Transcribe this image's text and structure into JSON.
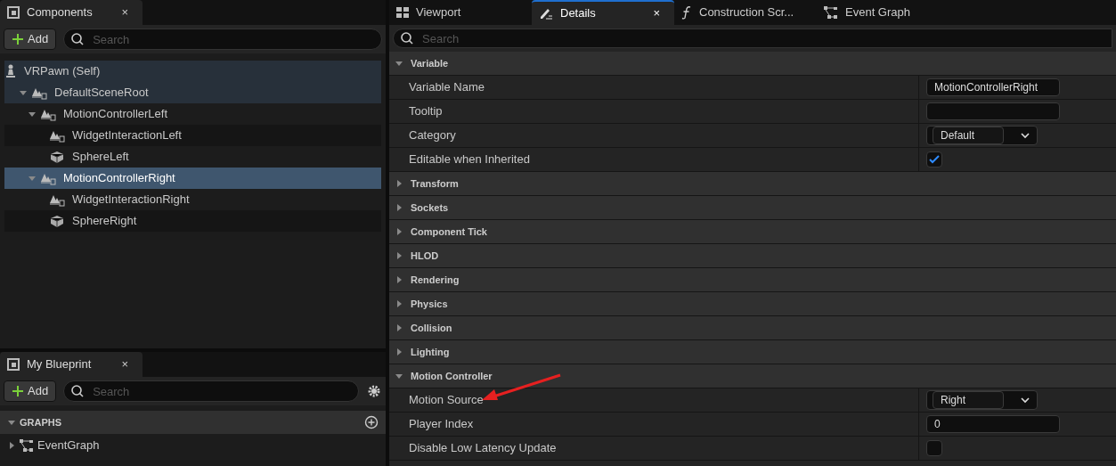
{
  "components_panel": {
    "tab": {
      "label": "Components",
      "close": "×"
    },
    "add_button": "Add",
    "search": {
      "placeholder": "Search"
    },
    "tree": [
      {
        "label": "VRPawn (Self)",
        "kind": "pawn",
        "selected": false,
        "inherited": true,
        "children": [
          {
            "label": "DefaultSceneRoot",
            "kind": "scene",
            "selected": false,
            "inherited": true,
            "expanded": true,
            "children": [
              {
                "label": "MotionControllerLeft",
                "kind": "scene",
                "selected": false,
                "inherited": false,
                "expanded": true,
                "children": [
                  {
                    "label": "WidgetInteractionLeft",
                    "kind": "scene",
                    "selected": false,
                    "inherited": false
                  },
                  {
                    "label": "SphereLeft",
                    "kind": "mesh",
                    "selected": false,
                    "inherited": false
                  }
                ]
              },
              {
                "label": "MotionControllerRight",
                "kind": "scene",
                "selected": true,
                "inherited": false,
                "expanded": true,
                "children": [
                  {
                    "label": "WidgetInteractionRight",
                    "kind": "scene",
                    "selected": false,
                    "inherited": false
                  },
                  {
                    "label": "SphereRight",
                    "kind": "mesh",
                    "selected": false,
                    "inherited": false
                  }
                ]
              }
            ]
          }
        ]
      }
    ]
  },
  "blueprint_panel": {
    "tab": {
      "label": "My Blueprint",
      "close": "×"
    },
    "add_button": "Add",
    "search": {
      "placeholder": "Search"
    },
    "section": {
      "label": "GRAPHS",
      "expanded": true
    },
    "items": [
      {
        "label": "EventGraph",
        "expanded": false
      }
    ]
  },
  "tabs": [
    {
      "label": "Viewport",
      "selected": false
    },
    {
      "label": "Details",
      "selected": true,
      "close": "×"
    },
    {
      "label": "Construction Scr...",
      "selected": false
    },
    {
      "label": "Event Graph",
      "selected": false
    }
  ],
  "details": {
    "search": {
      "placeholder": "Search"
    },
    "sections": [
      {
        "label": "Variable",
        "expanded": true,
        "rows": [
          {
            "label": "Variable Name",
            "kind": "text",
            "value": "MotionControllerRight"
          },
          {
            "label": "Tooltip",
            "kind": "text",
            "value": ""
          },
          {
            "label": "Category",
            "kind": "dropdown",
            "value": "Default"
          },
          {
            "label": "Editable when Inherited",
            "kind": "checkbox",
            "checked": true
          }
        ]
      },
      {
        "label": "Transform",
        "expanded": false
      },
      {
        "label": "Sockets",
        "expanded": false
      },
      {
        "label": "Component Tick",
        "expanded": false
      },
      {
        "label": "HLOD",
        "expanded": false
      },
      {
        "label": "Rendering",
        "expanded": false
      },
      {
        "label": "Physics",
        "expanded": false
      },
      {
        "label": "Collision",
        "expanded": false
      },
      {
        "label": "Lighting",
        "expanded": false
      },
      {
        "label": "Motion Controller",
        "expanded": true,
        "rows": [
          {
            "label": "Motion Source",
            "kind": "dropdown",
            "value": "Right",
            "annotated": true
          },
          {
            "label": "Player Index",
            "kind": "text",
            "value": "0"
          },
          {
            "label": "Disable Low Latency Update",
            "kind": "checkbox",
            "checked": false
          }
        ]
      }
    ]
  }
}
